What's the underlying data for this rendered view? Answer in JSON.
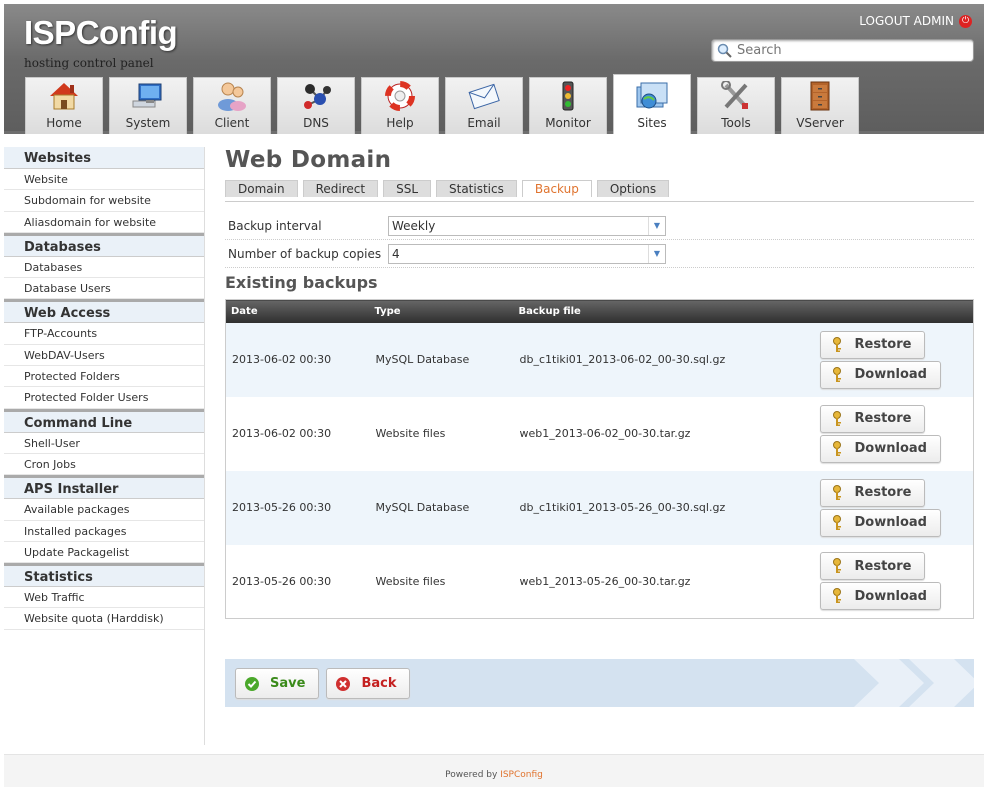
{
  "header": {
    "logo_main": "ISPConfig",
    "tagline": "hosting control panel",
    "logout_label": "LOGOUT ADMIN",
    "search_placeholder": "Search"
  },
  "nav_tabs": [
    {
      "label": "Home",
      "icon": "house-icon"
    },
    {
      "label": "System",
      "icon": "computer-icon"
    },
    {
      "label": "Client",
      "icon": "users-icon"
    },
    {
      "label": "DNS",
      "icon": "molecule-icon"
    },
    {
      "label": "Help",
      "icon": "lifebuoy-icon"
    },
    {
      "label": "Email",
      "icon": "envelope-icon"
    },
    {
      "label": "Monitor",
      "icon": "traffic-light-icon"
    },
    {
      "label": "Sites",
      "icon": "globe-folder-icon",
      "active": true
    },
    {
      "label": "Tools",
      "icon": "tools-icon"
    },
    {
      "label": "VServer",
      "icon": "cabinet-icon"
    }
  ],
  "sidebar": {
    "groups": [
      {
        "title": "Websites",
        "items": [
          "Website",
          "Subdomain for website",
          "Aliasdomain for website"
        ]
      },
      {
        "title": "Databases",
        "items": [
          "Databases",
          "Database Users"
        ]
      },
      {
        "title": "Web Access",
        "items": [
          "FTP-Accounts",
          "WebDAV-Users",
          "Protected Folders",
          "Protected Folder Users"
        ]
      },
      {
        "title": "Command Line",
        "items": [
          "Shell-User",
          "Cron Jobs"
        ]
      },
      {
        "title": "APS Installer",
        "items": [
          "Available packages",
          "Installed packages",
          "Update Packagelist"
        ]
      },
      {
        "title": "Statistics",
        "items": [
          "Web Traffic",
          "Website quota (Harddisk)"
        ]
      }
    ]
  },
  "main": {
    "title": "Web Domain",
    "form_tabs": [
      "Domain",
      "Redirect",
      "SSL",
      "Statistics",
      "Backup",
      "Options"
    ],
    "active_form_tab": "Backup",
    "fields": {
      "backup_interval_label": "Backup interval",
      "backup_interval_value": "Weekly",
      "backup_copies_label": "Number of backup copies",
      "backup_copies_value": "4"
    },
    "existing_backups_title": "Existing backups",
    "table": {
      "headers": [
        "Date",
        "Type",
        "Backup file"
      ],
      "rows": [
        {
          "date": "2013-06-02 00:30",
          "type": "MySQL Database",
          "file": "db_c1tiki01_2013-06-02_00-30.sql.gz"
        },
        {
          "date": "2013-06-02 00:30",
          "type": "Website files",
          "file": "web1_2013-06-02_00-30.tar.gz"
        },
        {
          "date": "2013-05-26 00:30",
          "type": "MySQL Database",
          "file": "db_c1tiki01_2013-05-26_00-30.sql.gz"
        },
        {
          "date": "2013-05-26 00:30",
          "type": "Website files",
          "file": "web1_2013-05-26_00-30.tar.gz"
        }
      ],
      "restore_label": "Restore",
      "download_label": "Download"
    },
    "save_label": "Save",
    "back_label": "Back"
  },
  "footer": {
    "prefix": "Powered by",
    "brand": "ISPConfig"
  },
  "colors": {
    "accent_orange": "#e0742f",
    "save_green": "#3a8a1a",
    "back_red": "#c42020",
    "row_blue": "#eef5fb"
  }
}
